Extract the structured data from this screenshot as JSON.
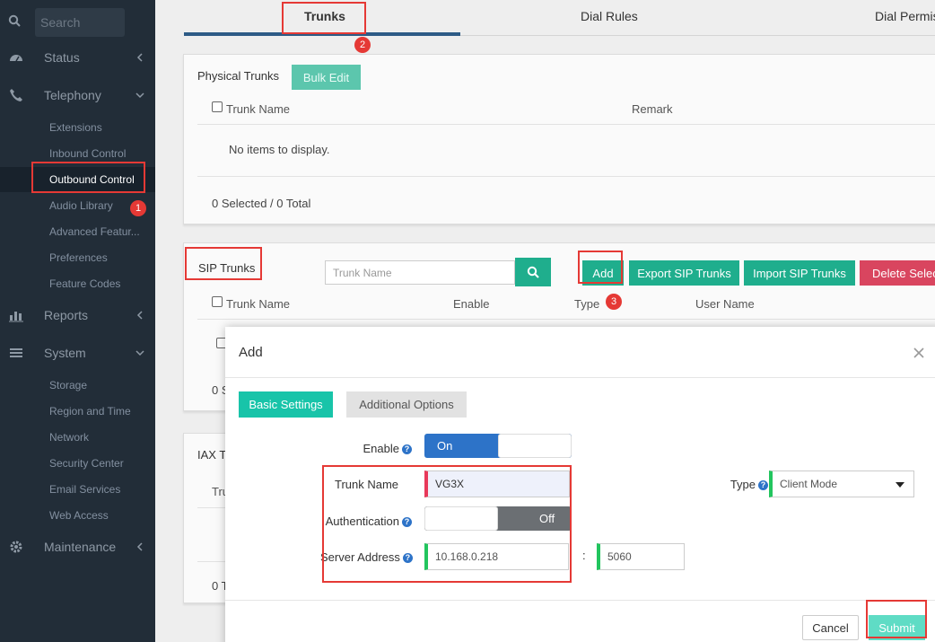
{
  "sidebar": {
    "search_placeholder": "Search",
    "groups": [
      {
        "label": "Status",
        "icon": "dashboard-icon"
      },
      {
        "label": "Telephony",
        "icon": "phone-icon"
      },
      {
        "label": "Reports",
        "icon": "bar-chart-icon"
      },
      {
        "label": "System",
        "icon": "list-icon"
      },
      {
        "label": "Maintenance",
        "icon": "gear-icon"
      }
    ],
    "telephony_items": [
      "Extensions",
      "Inbound Control",
      "Outbound Control",
      "Audio Library",
      "Advanced Featur...",
      "Preferences",
      "Feature Codes"
    ],
    "system_items": [
      "Storage",
      "Region and Time",
      "Network",
      "Security Center",
      "Email Services",
      "Web Access"
    ]
  },
  "tabs": [
    "Trunks",
    "Dial Rules",
    "Dial Permis"
  ],
  "physical_trunks": {
    "title": "Physical Trunks",
    "bulk_edit": "Bulk Edit",
    "columns": [
      "Trunk Name",
      "Remark"
    ],
    "empty": "No items to display.",
    "footer": "0 Selected / 0 Total"
  },
  "sip_trunks": {
    "title": "SIP Trunks",
    "search_placeholder": "Trunk Name",
    "buttons": {
      "add": "Add",
      "export": "Export SIP Trunks",
      "import": "Import SIP Trunks",
      "delete": "Delete Selecte"
    },
    "columns": [
      "Trunk Name",
      "Enable",
      "Type",
      "User Name"
    ],
    "footer_partial": "0 S"
  },
  "iax_trunks": {
    "title_partial": "IAX Tr",
    "col_partial": "Tru",
    "footer_partial": "0 T"
  },
  "modal": {
    "title": "Add",
    "tabs": [
      "Basic Settings",
      "Additional Options"
    ],
    "enable_label": "Enable",
    "enable_state": "On",
    "trunk_name_label": "Trunk Name",
    "trunk_name_value": "VG3X",
    "type_label": "Type",
    "type_value": "Client Mode",
    "auth_label": "Authentication",
    "auth_state": "Off",
    "server_label": "Server Address",
    "server_value": "10.168.0.218",
    "port_sep": ":",
    "port_value": "5060",
    "cancel": "Cancel",
    "submit": "Submit"
  },
  "annotations": [
    "1",
    "2",
    "3"
  ],
  "colors": {
    "accent": "#1fae8d",
    "sidebar": "#222d38",
    "annotation": "#e53935",
    "toggle_on": "#2d73c8"
  }
}
